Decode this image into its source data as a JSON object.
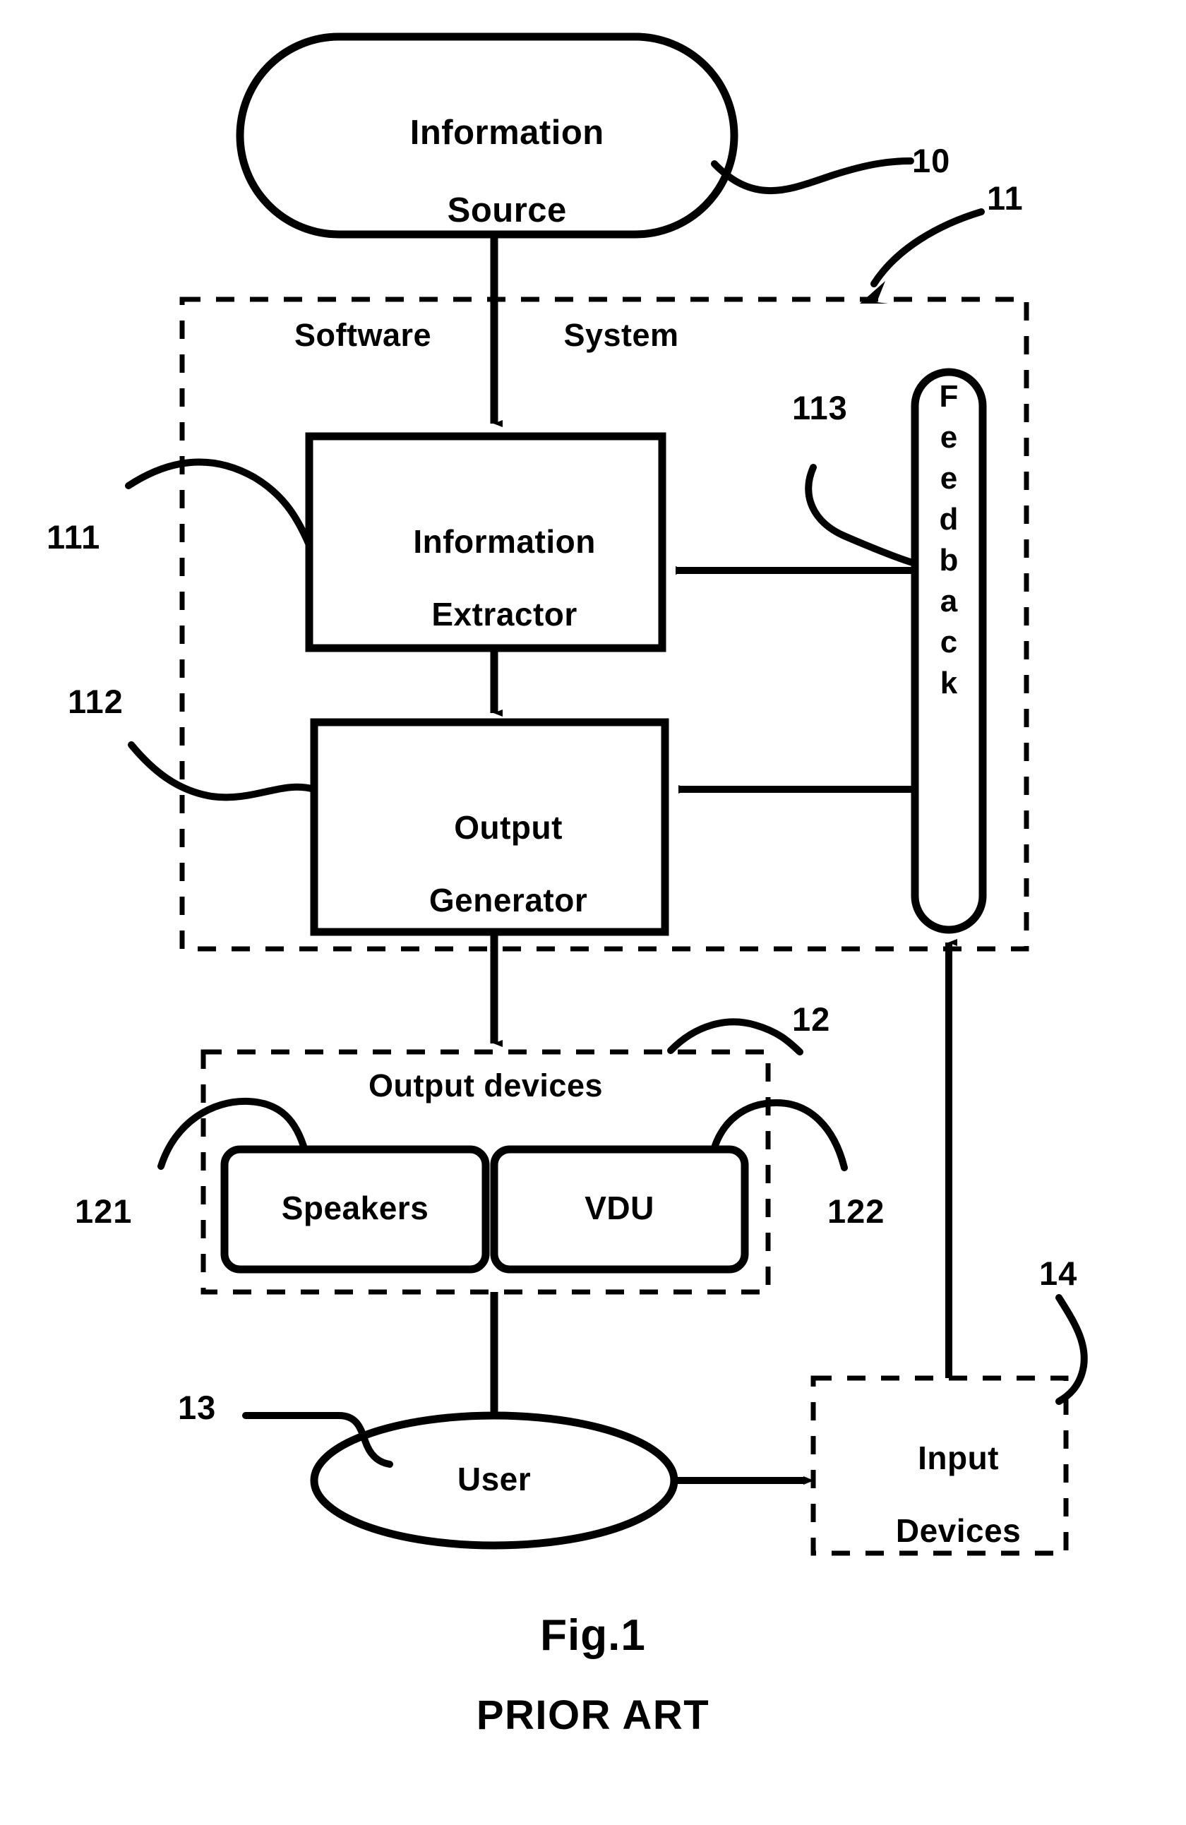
{
  "figure": {
    "caption_main": "Fig.1",
    "caption_sub": "PRIOR ART"
  },
  "nodes": {
    "information_source": {
      "label_line1": "Information",
      "label_line2": "Source",
      "ref": "10",
      "shape": "stadium"
    },
    "software_system": {
      "label_left": "Software",
      "label_right": "System",
      "ref": "11",
      "shape": "dashed-rect"
    },
    "information_extractor": {
      "label_line1": "Information",
      "label_line2": "Extractor",
      "ref": "111",
      "shape": "rect"
    },
    "output_generator": {
      "label_line1": "Output",
      "label_line2": "Generator",
      "ref": "112",
      "shape": "rect"
    },
    "feedback": {
      "label": "Feedback",
      "letters": [
        "F",
        "e",
        "e",
        "d",
        "b",
        "a",
        "c",
        "k"
      ],
      "ref": "113",
      "shape": "vertical-capsule"
    },
    "output_devices": {
      "label": "Output devices",
      "ref": "12",
      "shape": "dashed-rect"
    },
    "speakers": {
      "label": "Speakers",
      "ref": "121",
      "shape": "rounded-rect"
    },
    "vdu": {
      "label": "VDU",
      "ref": "122",
      "shape": "rounded-rect"
    },
    "user": {
      "label": "User",
      "ref": "13",
      "shape": "ellipse"
    },
    "input_devices": {
      "label_line1": "Input",
      "label_line2": "Devices",
      "ref": "14",
      "shape": "dashed-rect"
    }
  },
  "colors": {
    "ink": "#000000",
    "paper": "#ffffff"
  }
}
